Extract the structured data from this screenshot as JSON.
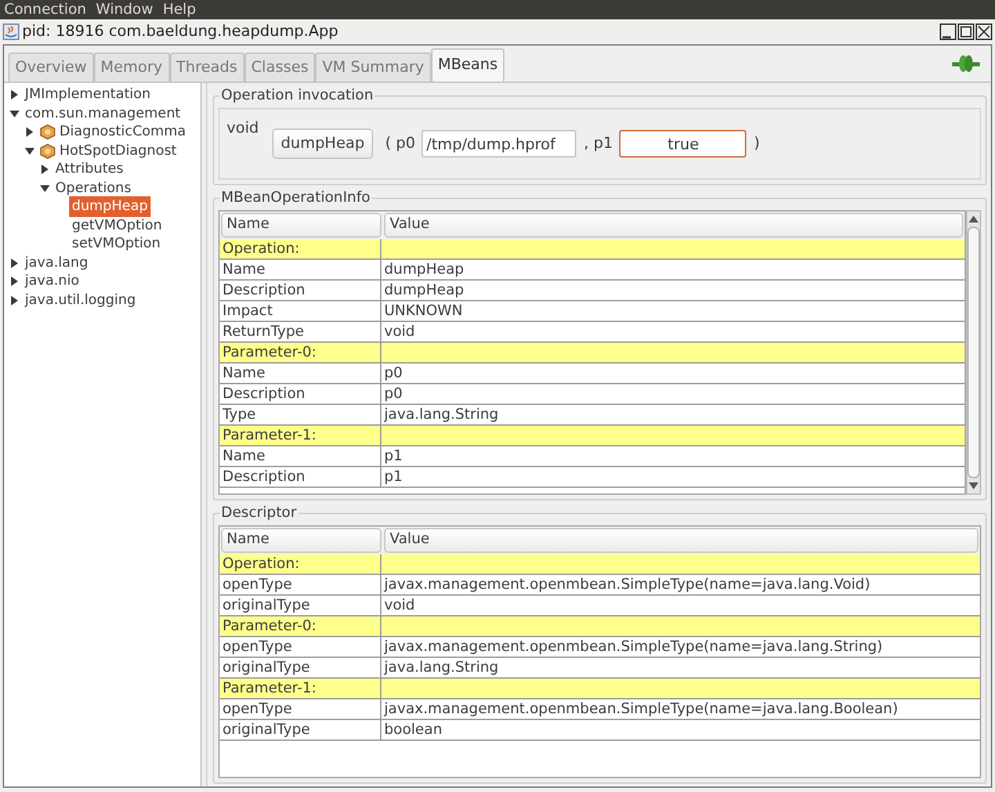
{
  "menu": [
    "Connection",
    "Window",
    "Help"
  ],
  "window": {
    "title": "pid: 18916 com.baeldung.heapdump.App"
  },
  "tabs": [
    {
      "label": "Overview",
      "selected": false
    },
    {
      "label": "Memory",
      "selected": false
    },
    {
      "label": "Threads",
      "selected": false
    },
    {
      "label": "Classes",
      "selected": false
    },
    {
      "label": "VM Summary",
      "selected": false
    },
    {
      "label": "MBeans",
      "selected": true
    }
  ],
  "tree": [
    {
      "label": "JMImplementation",
      "kind": "node",
      "expanded": false
    },
    {
      "label": "com.sun.management",
      "kind": "node",
      "expanded": true,
      "children": [
        {
          "label": "DiagnosticComma",
          "kind": "bean",
          "expanded": false
        },
        {
          "label": "HotSpotDiagnost",
          "kind": "bean",
          "expanded": true,
          "children": [
            {
              "label": "Attributes",
              "kind": "node",
              "expanded": false
            },
            {
              "label": "Operations",
              "kind": "node",
              "expanded": true,
              "children": [
                {
                  "label": "dumpHeap",
                  "kind": "leaf",
                  "selected": true
                },
                {
                  "label": "getVMOption",
                  "kind": "leaf",
                  "selected": false
                },
                {
                  "label": "setVMOption",
                  "kind": "leaf",
                  "selected": false
                }
              ]
            }
          ]
        }
      ]
    },
    {
      "label": "java.lang",
      "kind": "node",
      "expanded": false
    },
    {
      "label": "java.nio",
      "kind": "node",
      "expanded": false
    },
    {
      "label": "java.util.logging",
      "kind": "node",
      "expanded": false
    }
  ],
  "invocation": {
    "title": "Operation invocation",
    "return_type": "void",
    "button": "dumpHeap",
    "open": "( p0",
    "p0": "/tmp/dump.hprof",
    "sep": ", p1",
    "p1": "true",
    "close": ")"
  },
  "operation_info": {
    "title": "MBeanOperationInfo",
    "columns": [
      "Name",
      "Value"
    ],
    "rows": [
      {
        "kind": "section",
        "name": "Operation:",
        "value": ""
      },
      {
        "kind": "row",
        "name": "Name",
        "value": "dumpHeap"
      },
      {
        "kind": "row",
        "name": "Description",
        "value": "dumpHeap"
      },
      {
        "kind": "row",
        "name": "Impact",
        "value": "UNKNOWN"
      },
      {
        "kind": "row",
        "name": "ReturnType",
        "value": "void"
      },
      {
        "kind": "section",
        "name": "Parameter-0:",
        "value": ""
      },
      {
        "kind": "row",
        "name": "Name",
        "value": "p0"
      },
      {
        "kind": "row",
        "name": "Description",
        "value": "p0"
      },
      {
        "kind": "row",
        "name": "Type",
        "value": "java.lang.String"
      },
      {
        "kind": "section",
        "name": "Parameter-1:",
        "value": ""
      },
      {
        "kind": "row",
        "name": "Name",
        "value": "p1"
      },
      {
        "kind": "row",
        "name": "Description",
        "value": "p1"
      }
    ]
  },
  "descriptor": {
    "title": "Descriptor",
    "columns": [
      "Name",
      "Value"
    ],
    "rows": [
      {
        "kind": "section",
        "name": "Operation:",
        "value": ""
      },
      {
        "kind": "row",
        "name": "openType",
        "value": "javax.management.openmbean.SimpleType(name=java.lang.Void)"
      },
      {
        "kind": "row",
        "name": "originalType",
        "value": "void"
      },
      {
        "kind": "section",
        "name": "Parameter-0:",
        "value": ""
      },
      {
        "kind": "row",
        "name": "openType",
        "value": "javax.management.openmbean.SimpleType(name=java.lang.String)"
      },
      {
        "kind": "row",
        "name": "originalType",
        "value": "java.lang.String"
      },
      {
        "kind": "section",
        "name": "Parameter-1:",
        "value": ""
      },
      {
        "kind": "row",
        "name": "openType",
        "value": "javax.management.openmbean.SimpleType(name=java.lang.Boolean)"
      },
      {
        "kind": "row",
        "name": "originalType",
        "value": "boolean"
      }
    ]
  }
}
